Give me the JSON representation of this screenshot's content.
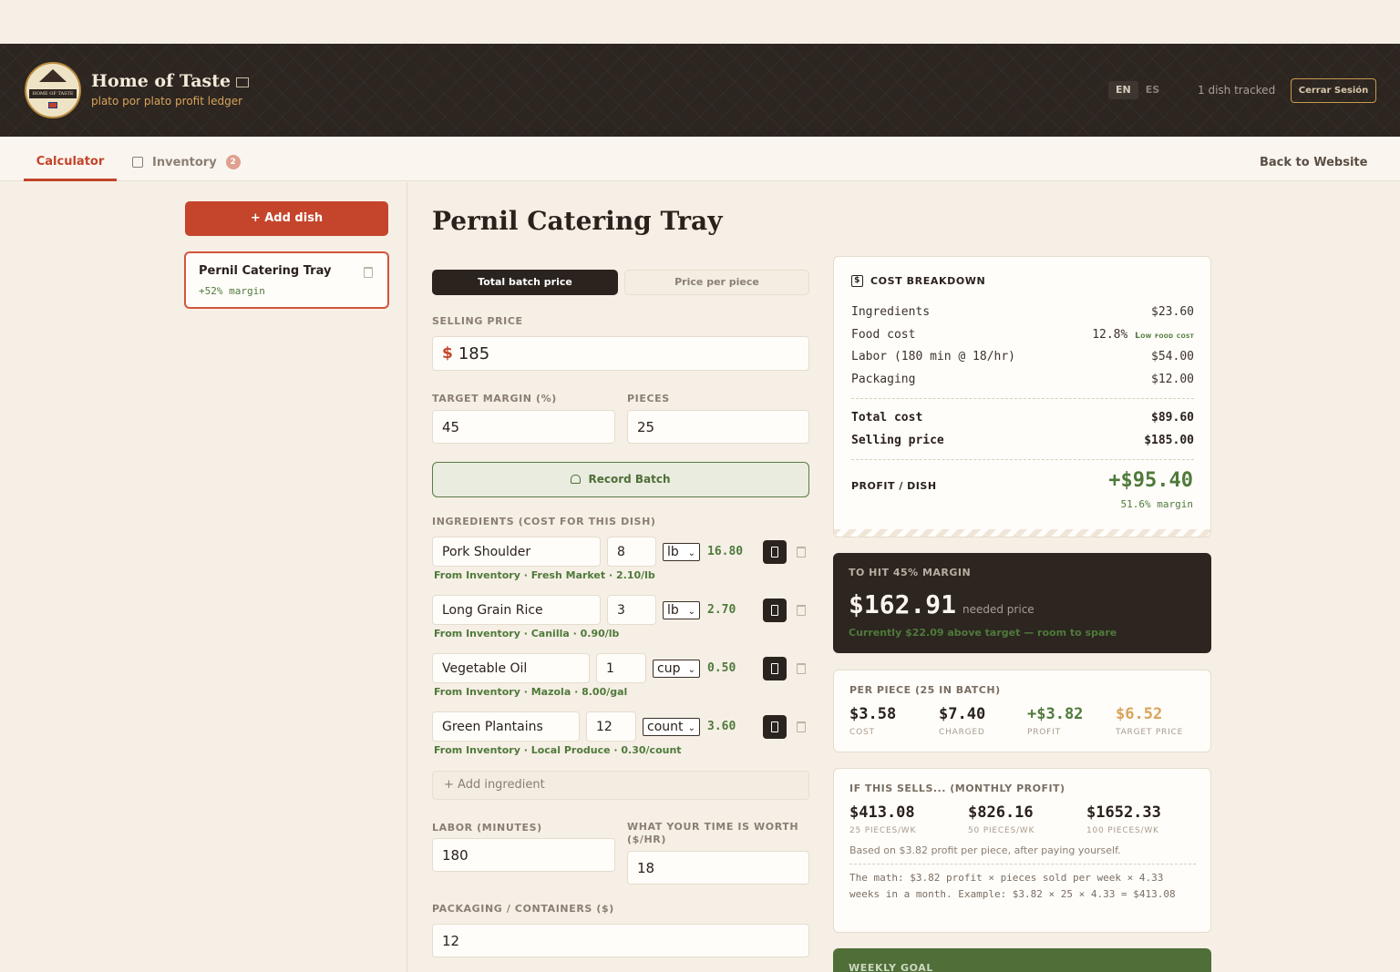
{
  "header": {
    "brand_title": "Home of Taste",
    "brand_subtitle": "plato por plato profit ledger",
    "logo_text": "HOME OF TASTE",
    "lang_en": "EN",
    "lang_es": "ES",
    "tracked": "1 dish tracked",
    "signout_label": "Cerrar Sesión"
  },
  "nav": {
    "tab_calculator": "Calculator",
    "tab_inventory": "Inventory",
    "inventory_badge": "2",
    "back_link": "Back to Website"
  },
  "sidebar": {
    "add_dish_label": "+ Add dish",
    "dishes": [
      {
        "name": "Pernil Catering Tray",
        "margin": "+52% margin"
      }
    ]
  },
  "main": {
    "title": "Pernil Catering Tray",
    "pricing_modes": [
      "Total batch price",
      "Price per piece"
    ],
    "selling_price_label": "SELLING PRICE",
    "currency_symbol": "$",
    "selling_price": "185",
    "target_margin_label": "TARGET MARGIN (%)",
    "target_margin": "45",
    "pieces_label": "PIECES",
    "pieces": "25",
    "record_batch_label": "Record Batch",
    "ingredients_label": "INGREDIENTS (COST FOR THIS DISH)",
    "ingredients": [
      {
        "name": "Pork Shoulder",
        "qty": "8",
        "unit": "lb",
        "cost": "16.80",
        "source": "From Inventory · Fresh Market · 2.10/lb"
      },
      {
        "name": "Long Grain Rice",
        "qty": "3",
        "unit": "lb",
        "cost": "2.70",
        "source": "From Inventory · Canilla · 0.90/lb"
      },
      {
        "name": "Vegetable Oil",
        "qty": "1",
        "unit": "cup",
        "cost": "0.50",
        "source": "From Inventory · Mazola · 8.00/gal"
      },
      {
        "name": "Green Plantains",
        "qty": "12",
        "unit": "count",
        "cost": "3.60",
        "source": "From Inventory · Local Produce · 0.30/count"
      }
    ],
    "add_ingredient_label": "+ Add ingredient",
    "labor_label": "LABOR (MINUTES)",
    "labor_minutes": "180",
    "rate_label": "WHAT YOUR TIME IS WORTH ($/HR)",
    "rate": "18",
    "packaging_label": "PACKAGING / CONTAINERS ($)",
    "packaging": "12"
  },
  "cost_breakdown": {
    "title": "COST BREAKDOWN",
    "icon": "$",
    "ingredients_label": "Ingredients",
    "ingredients_value": "$23.60",
    "food_cost_label": "Food cost",
    "food_cost_value": "12.8%",
    "food_cost_tag": "Low food cost",
    "labor_label": "Labor (180 min @ 18/hr)",
    "labor_value": "$54.00",
    "packaging_label": "Packaging",
    "packaging_value": "$12.00",
    "total_label": "Total cost",
    "total_value": "$89.60",
    "selling_label": "Selling price",
    "selling_value": "$185.00",
    "profit_label": "PROFIT / DISH",
    "profit_value": "+$95.40",
    "profit_margin": "51.6% margin"
  },
  "target_card": {
    "title": "TO HIT 45% MARGIN",
    "price": "$162.91",
    "price_note": "needed price",
    "status": "Currently $22.09 above target — room to spare"
  },
  "per_piece": {
    "title": "PER PIECE (25 IN BATCH)",
    "items": [
      {
        "value": "$3.58",
        "caption": "COST"
      },
      {
        "value": "$7.40",
        "caption": "CHARGED"
      },
      {
        "value": "+$3.82",
        "caption": "PROFIT"
      },
      {
        "value": "$6.52",
        "caption": "TARGET PRICE"
      }
    ]
  },
  "monthly": {
    "title": "IF THIS SELLS... (MONTHLY PROFIT)",
    "items": [
      {
        "value": "$413.08",
        "caption": "25 PIECES/WK"
      },
      {
        "value": "$826.16",
        "caption": "50 PIECES/WK"
      },
      {
        "value": "$1652.33",
        "caption": "100 PIECES/WK"
      }
    ],
    "note": "Based on $3.82 profit per piece, after paying yourself.",
    "math": "The math: $3.82 profit × pieces sold per week × 4.33 weeks in a month. Example: $3.82 × 25 × 4.33 = $413.08"
  },
  "weekly_goal": {
    "title": "WEEKLY GOAL"
  },
  "colors": {
    "accent": "#c4452c",
    "dark": "#2c2520",
    "green": "#4f7a3b",
    "gold": "#d9a35a"
  }
}
